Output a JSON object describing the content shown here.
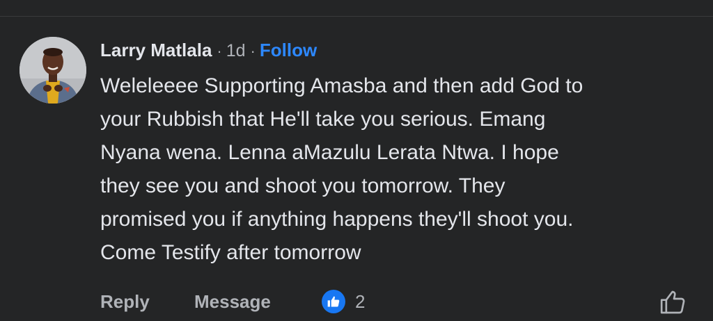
{
  "comment": {
    "author": "Larry Matlala",
    "separator": "·",
    "time": "1d",
    "follow_label": "Follow",
    "text": "Weleleeee Supporting Amasba and then add God to\nyour Rubbish that He'll take you serious. Emang\nNyana wena. Lenna aMazulu Lerata Ntwa. I hope\nthey see you and shoot you tomorrow. They\npromised you if anything happens they'll shoot you.\nCome Testify after tomorrow"
  },
  "actions": {
    "reply_label": "Reply",
    "message_label": "Message",
    "like_count": "2",
    "reaction_icon": "thumbs-up-icon",
    "like_button_icon": "thumbs-up-outline-icon"
  },
  "colors": {
    "background": "#242526",
    "primary_text": "#e4e6eb",
    "secondary_text": "#b0b3b8",
    "link_blue": "#2d88ff",
    "like_blue": "#1877f2"
  }
}
